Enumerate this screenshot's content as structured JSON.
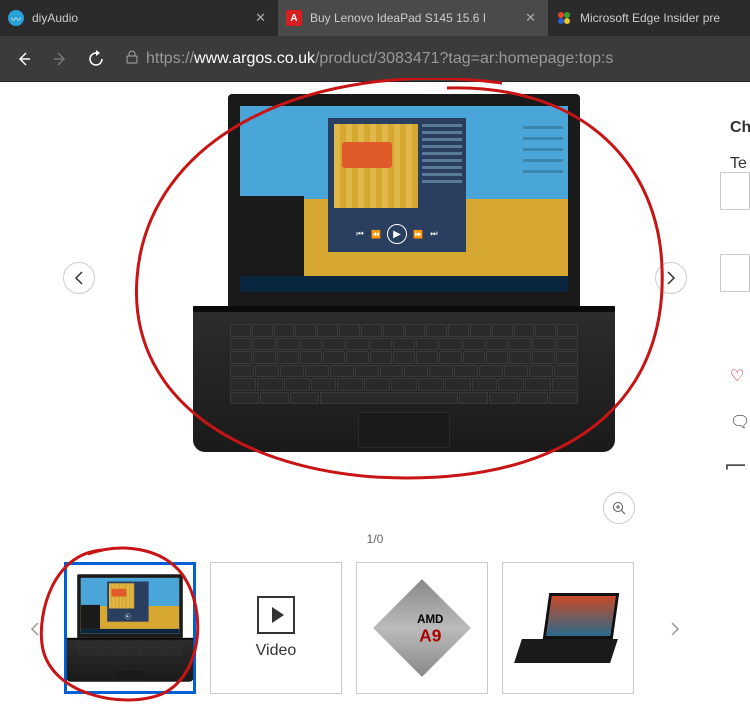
{
  "tabs": {
    "items": [
      {
        "title": "diyAudio",
        "active": false
      },
      {
        "title": "Buy Lenovo IdeaPad S145 15.6 I",
        "active": true
      },
      {
        "title": "Microsoft Edge Insider pre",
        "active": false
      }
    ]
  },
  "url": {
    "prefix": "https://",
    "host": "www.argos.co.uk",
    "path": "/product/3083471?tag=ar:homepage:top:s"
  },
  "carousel": {
    "counter": "1/0",
    "thumbs": {
      "video_label": "Video",
      "amd_line1": "AMD",
      "amd_line2": "A9"
    }
  },
  "sidebar": {
    "line1": "Ch",
    "line2": "Te"
  }
}
